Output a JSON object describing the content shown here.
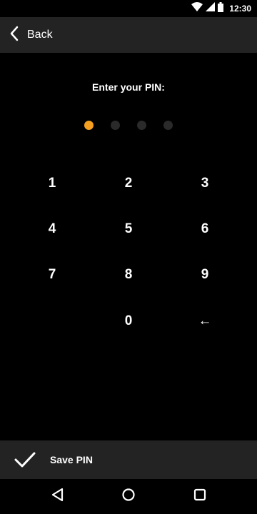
{
  "status_bar": {
    "time": "12:30",
    "icons": [
      "wifi-icon",
      "cell-signal-icon",
      "battery-icon"
    ]
  },
  "app_bar": {
    "back_label": "Back"
  },
  "pin": {
    "prompt": "Enter your PIN:",
    "length": 4,
    "filled": 1,
    "accent_color": "#f5a020",
    "empty_color": "#2a2a2a"
  },
  "keypad": {
    "keys": [
      {
        "label": "1",
        "name": "key-1"
      },
      {
        "label": "2",
        "name": "key-2"
      },
      {
        "label": "3",
        "name": "key-3"
      },
      {
        "label": "4",
        "name": "key-4"
      },
      {
        "label": "5",
        "name": "key-5"
      },
      {
        "label": "6",
        "name": "key-6"
      },
      {
        "label": "7",
        "name": "key-7"
      },
      {
        "label": "8",
        "name": "key-8"
      },
      {
        "label": "9",
        "name": "key-9"
      },
      {
        "label": "0",
        "name": "key-0"
      },
      {
        "label": "←",
        "name": "backspace-key"
      }
    ]
  },
  "save": {
    "label": "Save PIN",
    "icon": "check-icon"
  },
  "nav": {
    "icons": [
      "nav-back-icon",
      "nav-home-icon",
      "nav-recents-icon"
    ]
  },
  "colors": {
    "background": "#000000",
    "bar": "#232323",
    "accent": "#f5a020"
  }
}
